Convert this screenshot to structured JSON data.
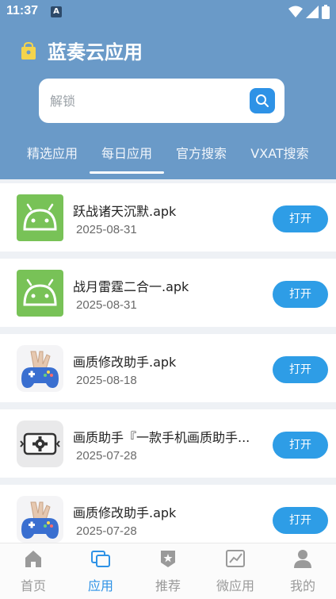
{
  "status_bar": {
    "time": "11:37",
    "notification_letter": "A",
    "battery_glyph": "8"
  },
  "header": {
    "app_title": "蓝奏云应用"
  },
  "search": {
    "value": "",
    "placeholder": "解锁"
  },
  "tabs": [
    {
      "label": "精选应用",
      "active": false
    },
    {
      "label": "每日应用",
      "active": true
    },
    {
      "label": "官方搜索",
      "active": false
    },
    {
      "label": "VXAT搜索",
      "active": false
    }
  ],
  "apps": [
    {
      "name": "跃战诸天沉默.apk",
      "date": "2025-08-31",
      "icon": "android-icon",
      "button": "打开"
    },
    {
      "name": "战月雷霆二合一.apk",
      "date": "2025-08-31",
      "icon": "android-icon",
      "button": "打开"
    },
    {
      "name": "画质修改助手.apk",
      "date": "2025-08-18",
      "icon": "gamepad-rock-icon",
      "button": "打开"
    },
    {
      "name": "画质助手『一款手机画质助手...",
      "date": "2025-07-28",
      "icon": "gear-screen-icon",
      "button": "打开"
    },
    {
      "name": "画质修改助手.apk",
      "date": "2025-07-28",
      "icon": "gamepad-rock-icon",
      "button": "打开"
    }
  ],
  "bottom_nav": [
    {
      "label": "首页",
      "icon": "home-icon",
      "active": false
    },
    {
      "label": "应用",
      "icon": "apps-icon",
      "active": true
    },
    {
      "label": "推荐",
      "icon": "star-badge-icon",
      "active": false
    },
    {
      "label": "微应用",
      "icon": "chart-icon",
      "active": false
    },
    {
      "label": "我的",
      "icon": "person-icon",
      "active": false
    }
  ],
  "colors": {
    "header_bg": "#6a9ac8",
    "accent": "#2e92e6",
    "android_green": "#78c257",
    "bag_yellow": "#f4d44d"
  }
}
